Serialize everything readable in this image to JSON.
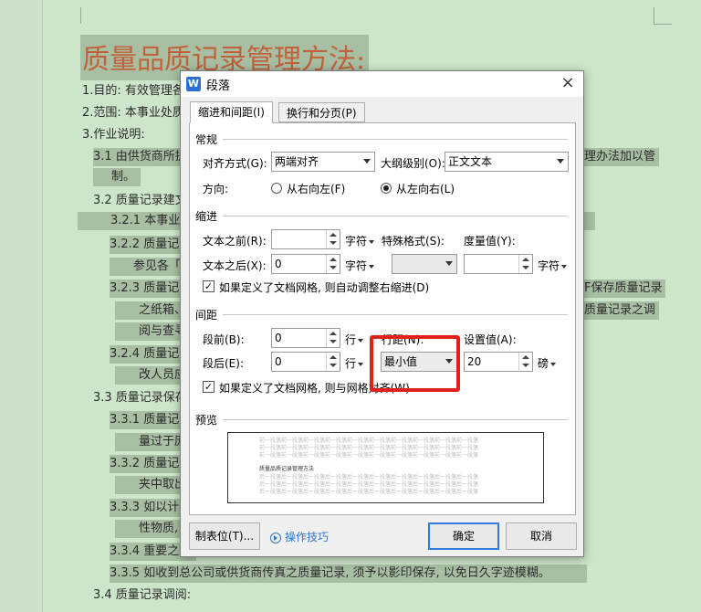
{
  "document": {
    "title": "质量品质记录管理方法:",
    "lines": [
      "1.目的:  有效管理各",
      "2.范围:  本事业处质",
      "3.作业说明:",
      "3.1 由供货商所提",
      "理办法加以管",
      "制。",
      "3.2 质量记录建文",
      "3.2.1 本事业处",
      "3.2.2 质量记录",
      "参见各「",
      "3.2.3 质量记录",
      "F保存质量记录",
      "之纸箱、",
      "质量记录之调",
      "阅与查寻",
      "3.2.4 质量记录",
      "改人员应",
      "3.3 质量记录保存",
      "3.3.1 质量记录",
      "量过于庞",
      "3.3.2 质量记录",
      "夹中取出",
      "3.3.3 如以计算",
      "性物质,",
      "3.3.4 重要之质",
      "3.3.5 如收到总公司或供货商传真之质量记录,  须予以影印保存,  以免日久字迹模糊。",
      "3.4 质量记录调阅:"
    ]
  },
  "dialog": {
    "app_icon": "W",
    "title": "段落",
    "close_icon": "×",
    "tabs": [
      {
        "label": "缩进和间距(I)",
        "active": true
      },
      {
        "label": "换行和分页(P)",
        "active": false
      }
    ],
    "general": {
      "section": "常规",
      "alignment_label": "对齐方式(G):",
      "alignment_value": "两端对齐",
      "outline_label": "大纲级别(O):",
      "outline_value": "正文文本",
      "direction_label": "方向:",
      "rtl_label": "从右向左(F)",
      "ltr_label": "从左向右(L)",
      "direction_selected": "ltr"
    },
    "indent": {
      "section": "缩进",
      "before_label": "文本之前(R):",
      "before_value": "",
      "before_unit": "字符",
      "after_label": "文本之后(X):",
      "after_value": "0",
      "after_unit": "字符",
      "special_label": "特殊格式(S):",
      "special_value": "",
      "measure_label": "度量值(Y):",
      "measure_value": "",
      "measure_unit": "字符",
      "grid_check_label": "如果定义了文档网格, 则自动调整右缩进(D)",
      "grid_checked": true
    },
    "spacing": {
      "section": "间距",
      "before_label": "段前(B):",
      "before_value": "0",
      "before_unit": "行",
      "after_label": "段后(E):",
      "after_value": "0",
      "after_unit": "行",
      "line_label": "行距(N):",
      "line_value": "最小值",
      "setting_label": "设置值(A):",
      "setting_value": "20",
      "setting_unit": "磅",
      "grid_check_label": "如果定义了文档网格, 则与网格对齐(W)",
      "grid_checked": true
    },
    "preview": {
      "section": "预览",
      "prev_text": "前一段落前一段落前一段落前一段落前一段落前一段落前一段落前一段落前一段落前一段落",
      "sample_text": "质量品质记录管理方法",
      "next_text": "后一段落后一段落后一段落后一段落后一段落后一段落后一段落后一段落后一段落后一段落"
    },
    "buttons": {
      "tabs_label": "制表位(T)...",
      "tips_label": "操作技巧",
      "ok_label": "确定",
      "cancel_label": "取消"
    },
    "highlight_color": "#e0201b"
  }
}
